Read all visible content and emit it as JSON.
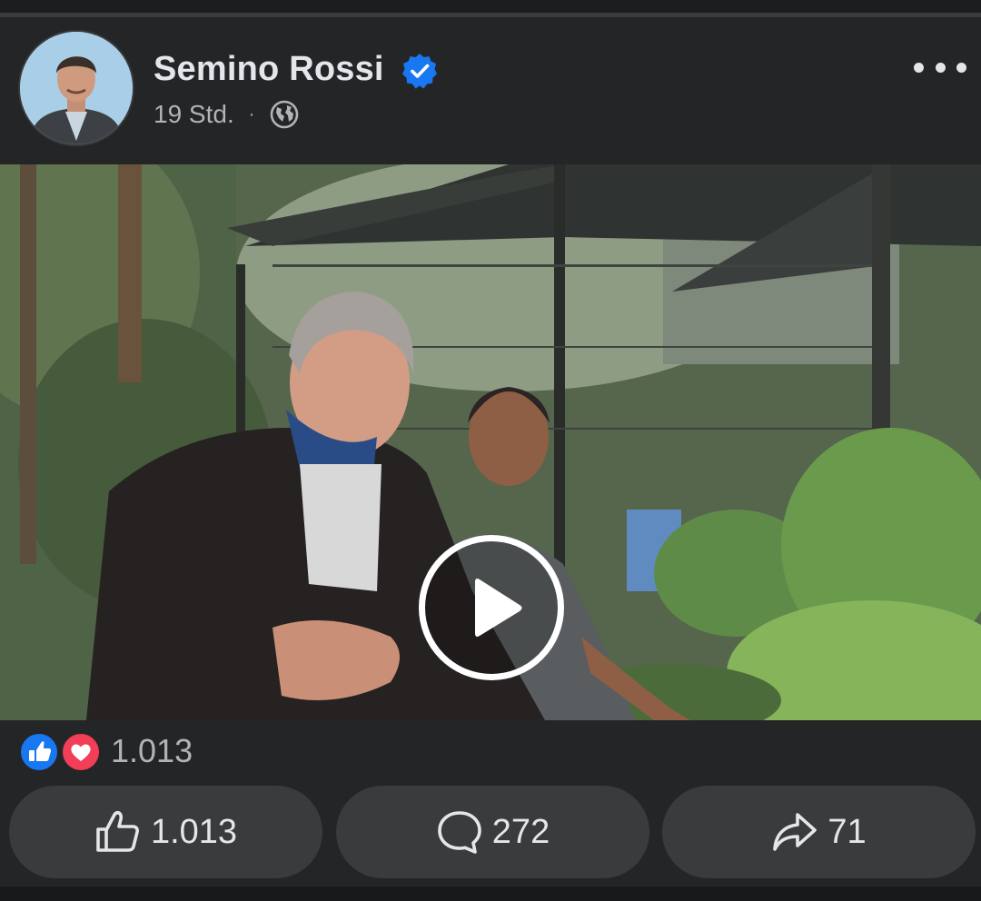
{
  "post": {
    "author": "Semino Rossi",
    "time": "19 Std.",
    "separator": "·"
  },
  "icons": {
    "verified": "verified-badge-icon",
    "audience": "globe-icon",
    "more": "more-options-icon",
    "play": "play-icon",
    "like": "like-icon",
    "comment": "comment-icon",
    "share": "share-icon"
  },
  "reactions": {
    "types": [
      "like",
      "love"
    ],
    "count": "1.013"
  },
  "actions": {
    "like_count": "1.013",
    "comment_count": "272",
    "share_count": "71"
  },
  "colors": {
    "background": "#242526",
    "button": "#3a3b3c",
    "verified": "#1877f2",
    "like": "#1877f2",
    "love": "#f33e58",
    "text": "#e4e6eb",
    "muted": "#b0b3b8"
  }
}
